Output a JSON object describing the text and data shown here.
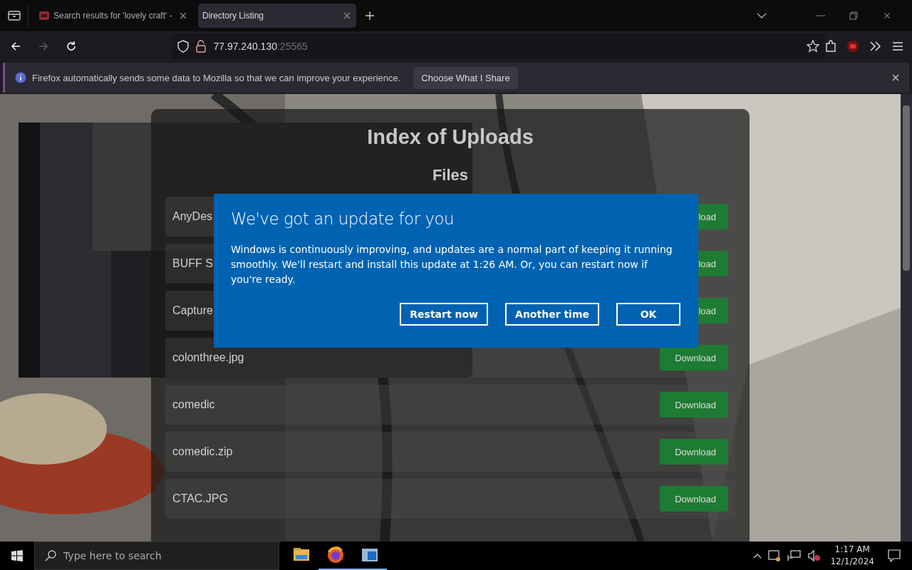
{
  "browser": {
    "tabs": [
      {
        "label": "Search results for 'lovely craft' -",
        "selected": false
      },
      {
        "label": "Directory Listing",
        "selected": true
      }
    ],
    "navigation": [
      {
        "kind": "back",
        "disabled": false
      },
      {
        "kind": "forward",
        "disabled": true
      },
      {
        "kind": "reload",
        "disabled": false
      }
    ],
    "url": {
      "host": "77.97.240.130",
      "port": ":25565"
    },
    "notification": {
      "text": "Firefox automatically sends some data to Mozilla so that we can improve your experience.",
      "button": "Choose What I Share"
    }
  },
  "page": {
    "title": "Index of Uploads",
    "subtitle": "Files",
    "files": [
      {
        "name": "AnyDes",
        "button": "load"
      },
      {
        "name": "BUFF S",
        "button": "load"
      },
      {
        "name": "Capture",
        "button": "load"
      },
      {
        "name": "colonthree.jpg",
        "button": "Download"
      },
      {
        "name": "comedic",
        "button": "Download"
      },
      {
        "name": "comedic.zip",
        "button": "Download"
      },
      {
        "name": "CTAC.JPG",
        "button": "Download"
      }
    ]
  },
  "dialog": {
    "title": "We've got an update for you",
    "body": "Windows is continuously improving, and updates are a normal part of keeping it running smoothly. We'll restart and install this update at 1:26 AM. Or, you can restart now if you're ready.",
    "buttons": [
      "Restart now",
      "Another time",
      "OK"
    ]
  },
  "taskbar": {
    "search_placeholder": "Type here to search",
    "apps": [
      {
        "kind": "folder",
        "active": false
      },
      {
        "kind": "browser",
        "active": true
      },
      {
        "kind": "window",
        "active": true
      }
    ],
    "time": "1:17 AM",
    "date": "12/1/2024"
  }
}
